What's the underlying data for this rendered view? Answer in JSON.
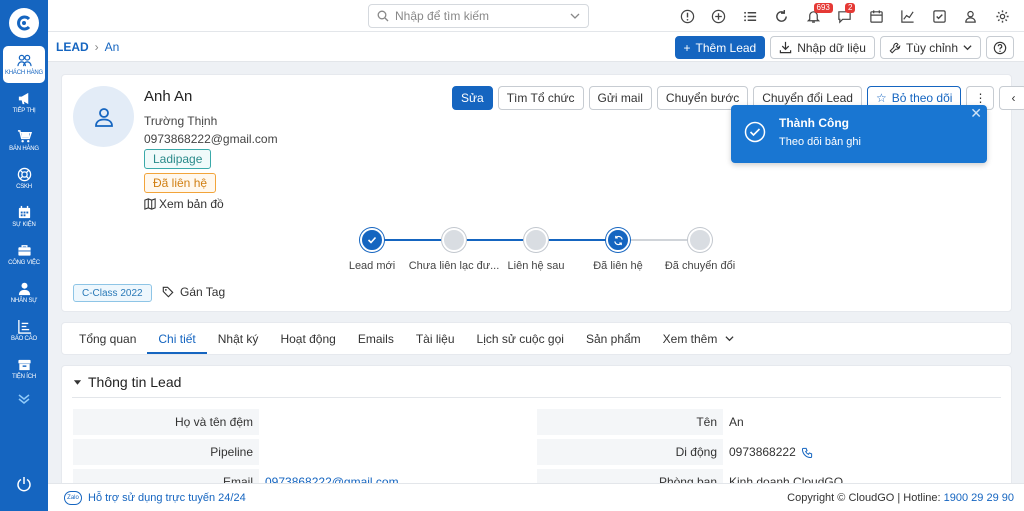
{
  "sidebar": {
    "items": [
      {
        "label": "Khách hàng",
        "icon": "users-icon",
        "active": true
      },
      {
        "label": "Tiếp thị",
        "icon": "megaphone-icon"
      },
      {
        "label": "Bán hàng",
        "icon": "cart-icon"
      },
      {
        "label": "CSKH",
        "icon": "support-icon"
      },
      {
        "label": "Sự kiện",
        "icon": "calendar-icon"
      },
      {
        "label": "Công việc",
        "icon": "briefcase-icon"
      },
      {
        "label": "Nhân sự",
        "icon": "person-icon"
      },
      {
        "label": "Báo cáo",
        "icon": "report-icon"
      },
      {
        "label": "Tiện ích",
        "icon": "box-icon"
      }
    ]
  },
  "topbar": {
    "search_placeholder": "Nhập để tìm kiếm",
    "notification_badge": "693",
    "chat_badge": "2"
  },
  "breadcrumb": {
    "root": "LEAD",
    "current": "An"
  },
  "actions": {
    "add_lead": "Thêm Lead",
    "import": "Nhập dữ liệu",
    "customize": "Tùy chỉnh"
  },
  "profile": {
    "name": "Anh An",
    "company": "Trường Thịnh",
    "email": "0973868222@gmail.com",
    "tag_source": "Ladipage",
    "tag_status": "Đã liên hệ",
    "map_link": "Xem bản đồ",
    "class_tag": "C-Class 2022",
    "add_tag": "Gán Tag"
  },
  "card_actions": {
    "edit": "Sửa",
    "find_org": "Tìm Tổ chức",
    "send_mail": "Gửi mail",
    "transfer": "Chuyển bước",
    "convert": "Chuyển đổi Lead",
    "follow": "Bỏ theo dõi"
  },
  "steps": [
    {
      "label": "Lead mới",
      "done": true
    },
    {
      "label": "Chưa liên lạc đư...",
      "done": false
    },
    {
      "label": "Liên hệ sau",
      "done": false
    },
    {
      "label": "Đã liên hệ",
      "done": true
    },
    {
      "label": "Đã chuyển đổi",
      "done": false
    }
  ],
  "toast": {
    "title": "Thành Công",
    "message": "Theo dõi bản ghi",
    "close": "✕"
  },
  "tabs": [
    "Tổng quan",
    "Chi tiết",
    "Nhật ký",
    "Hoạt động",
    "Emails",
    "Tài liệu",
    "Lịch sử cuộc gọi",
    "Sản phẩm",
    "Xem thêm"
  ],
  "active_tab": "Chi tiết",
  "detail": {
    "title": "Thông tin Lead",
    "fields": {
      "fullname_label": "Họ và tên đệm",
      "fullname_value": "",
      "name_label": "Tên",
      "name_value": "An",
      "pipeline_label": "Pipeline",
      "pipeline_value": "",
      "mobile_label": "Di động",
      "mobile_value": "0973868222",
      "email_label": "Email",
      "email_value": "0973868222@gmail.com",
      "dept_label": "Phòng ban",
      "dept_value": "Kinh doanh CloudGO"
    }
  },
  "footer": {
    "support": "Hỗ trợ sử dụng trực tuyến 24/24",
    "copyright": "Copyright © CloudGO | Hotline: ",
    "hotline": "1900 29 29 90"
  },
  "colors": {
    "primary": "#1565c0",
    "toast": "#1976d2",
    "badge": "#e53935"
  }
}
